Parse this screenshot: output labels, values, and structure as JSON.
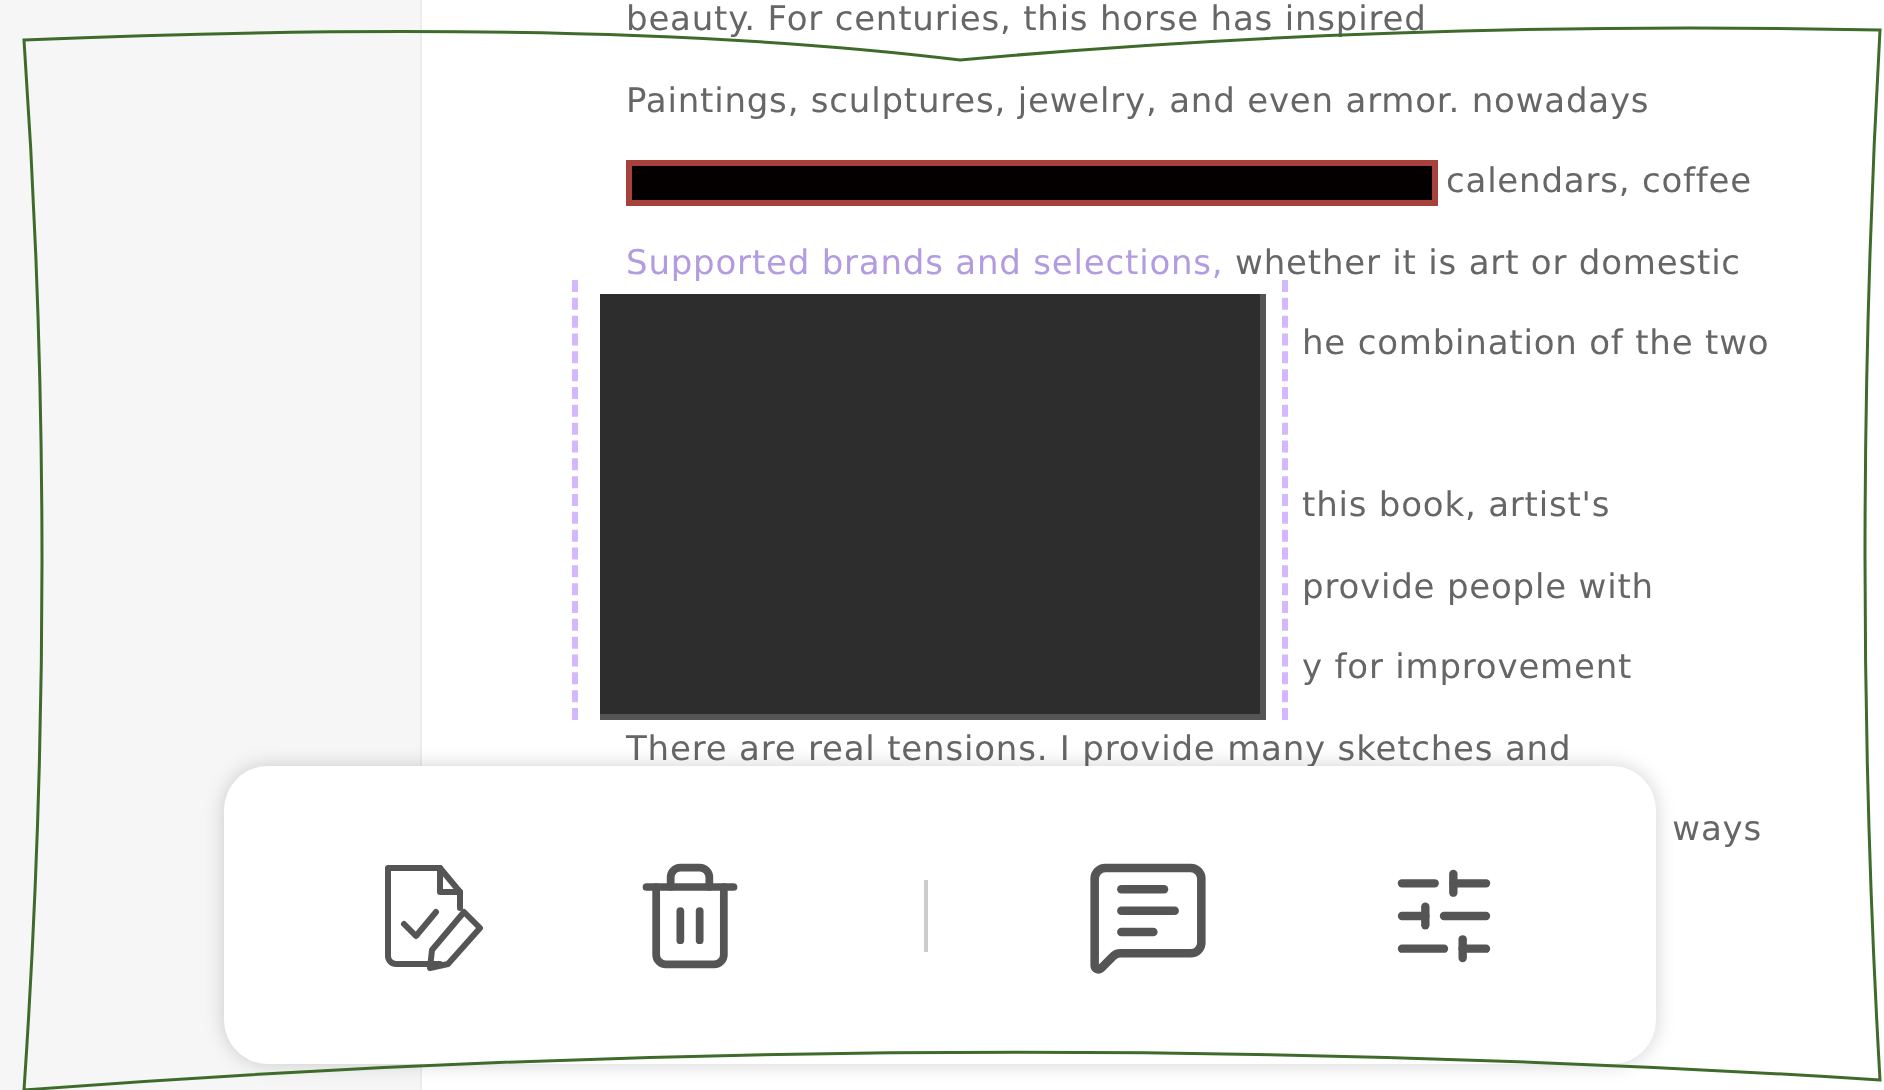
{
  "document": {
    "lines": [
      {
        "kind": "text",
        "text": "beauty. For centuries, this horse has inspired"
      },
      {
        "kind": "text",
        "text": "Paintings, sculptures, jewelry, and even armor. nowadays"
      },
      {
        "kind": "redacted",
        "text": "calendars, coffee"
      },
      {
        "kind": "text",
        "lead": "Supported brands and selections,",
        "text": " whether it is art or domestic"
      },
      {
        "kind": "beside",
        "text": "he combination of the two"
      },
      {
        "kind": "blank"
      },
      {
        "kind": "beside",
        "text": "this book, artist's"
      },
      {
        "kind": "beside",
        "text": "provide people with"
      },
      {
        "kind": "beside",
        "text": "y for improvement"
      },
      {
        "kind": "text",
        "text": "There are real tensions. I provide many sketches and"
      },
      {
        "kind": "tail",
        "text": "ways"
      }
    ],
    "image": {
      "selected": true
    }
  },
  "toolbar": {
    "items": [
      {
        "kind": "review"
      },
      {
        "kind": "delete"
      },
      {
        "kind": "divider"
      },
      {
        "kind": "comment"
      },
      {
        "kind": "adjust"
      }
    ]
  }
}
